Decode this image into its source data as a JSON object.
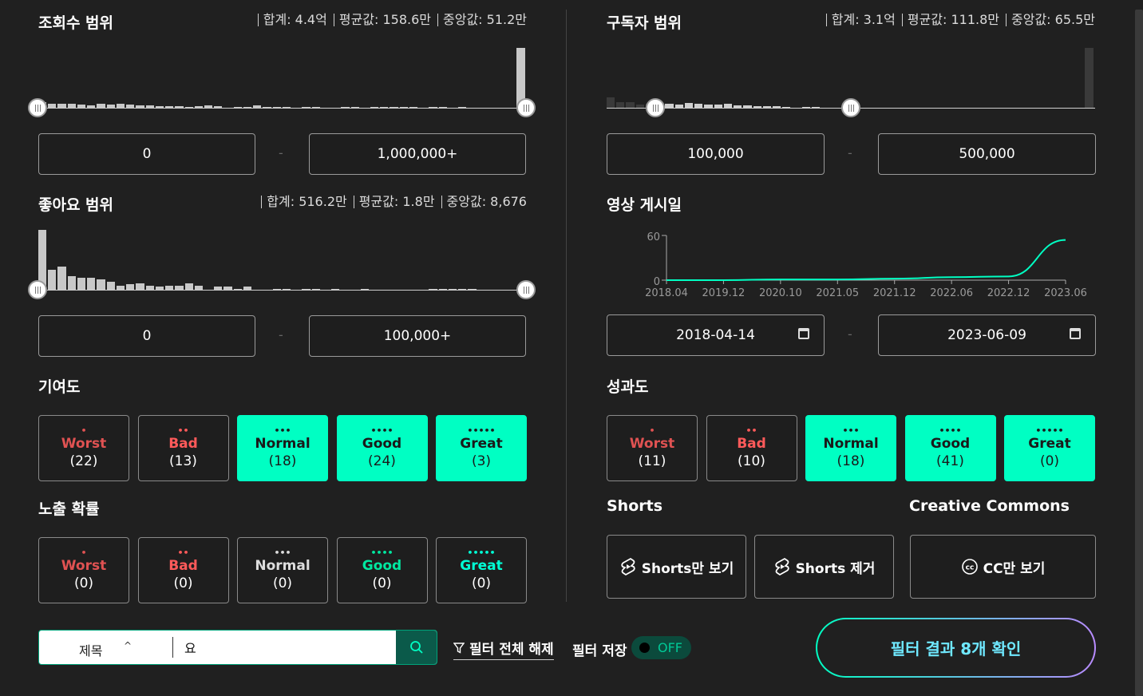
{
  "views": {
    "title": "조회수 범위",
    "stats": [
      "합계: 4.4억",
      "평균값: 158.6만",
      "중앙값: 51.2만"
    ],
    "min": "0",
    "max": "1,000,000+",
    "histogram": [
      0.1,
      0.08,
      0.07,
      0.07,
      0.06,
      0.05,
      0.07,
      0.06,
      0.08,
      0.06,
      0.05,
      0.05,
      0.04,
      0.04,
      0.04,
      0.03,
      0.04,
      0.05,
      0.04,
      0.0,
      0.03,
      0.03,
      0.05,
      0.03,
      0.03,
      0.03,
      0.0,
      0.02,
      0.02,
      0.0,
      0.0,
      0.02,
      0.02,
      0.0,
      0.02,
      0.02,
      0.02,
      0.02,
      0.02,
      0.0,
      0.02,
      0.02,
      0.0,
      0.02,
      0.0,
      0.0,
      0.0,
      0.0,
      0.0,
      0.95
    ]
  },
  "likes": {
    "title": "좋아요 범위",
    "stats": [
      "합계: 516.2만",
      "평균값: 1.8만",
      "중앙값: 8,676"
    ],
    "min": "0",
    "max": "100,000+",
    "histogram": [
      0.95,
      0.32,
      0.38,
      0.22,
      0.2,
      0.2,
      0.18,
      0.14,
      0.08,
      0.1,
      0.11,
      0.08,
      0.06,
      0.08,
      0.07,
      0.11,
      0.07,
      0.0,
      0.06,
      0.06,
      0.03,
      0.06,
      0.0,
      0.0,
      0.02,
      0.02,
      0.0,
      0.02,
      0.02,
      0.0,
      0.02,
      0.0,
      0.0,
      0.02,
      0.0,
      0.0,
      0.0,
      0.0,
      0.0,
      0.0,
      0.02,
      0.02,
      0.02,
      0.02,
      0.02,
      0.0,
      0.0,
      0.0,
      0.0,
      0.02
    ]
  },
  "subscribers": {
    "title": "구독자 범위",
    "stats": [
      "합계: 3.1억",
      "평균값: 111.8만",
      "중앙값: 65.5만"
    ],
    "min": "100,000",
    "max": "500,000",
    "sel_range": [
      0.1,
      0.5
    ],
    "histogram": [
      0.18,
      0.1,
      0.1,
      0.06,
      0.07,
      0.08,
      0.07,
      0.06,
      0.09,
      0.07,
      0.06,
      0.06,
      0.07,
      0.05,
      0.05,
      0.04,
      0.04,
      0.04,
      0.03,
      0.0,
      0.02,
      0.02,
      0.0,
      0.0,
      0.02,
      0.0,
      0.0,
      0.0,
      0.0,
      0.0,
      0.0,
      0.0,
      0.0,
      0.0,
      0.0,
      0.0,
      0.0,
      0.0,
      0.0,
      0.0,
      0.0,
      0.0,
      0.0,
      0.0,
      0.0,
      0.0,
      0.0,
      0.0,
      0.0,
      0.95
    ]
  },
  "upload_date": {
    "title": "영상 게시일",
    "start": "2018-04-14",
    "end": "2023-06-09"
  },
  "chart_data": {
    "type": "line",
    "x": [
      "2018.04",
      "2019.12",
      "2020.10",
      "2021.05",
      "2021.12",
      "2022.06",
      "2022.12",
      "2023.06"
    ],
    "ylim": [
      0,
      60
    ],
    "y_ticks": [
      "60",
      "0"
    ],
    "series": [
      {
        "values": [
          0,
          0,
          1,
          1,
          2,
          4,
          5,
          54
        ]
      }
    ]
  },
  "contribution": {
    "title": "기여도",
    "items": [
      {
        "dots": "•",
        "name": "Worst",
        "count": "(22)",
        "on": false,
        "cls": "c-worst"
      },
      {
        "dots": "••",
        "name": "Bad",
        "count": "(13)",
        "on": false,
        "cls": "c-bad"
      },
      {
        "dots": "•••",
        "name": "Normal",
        "count": "(18)",
        "on": true,
        "cls": "c-normal"
      },
      {
        "dots": "••••",
        "name": "Good",
        "count": "(24)",
        "on": true,
        "cls": "c-good"
      },
      {
        "dots": "•••••",
        "name": "Great",
        "count": "(3)",
        "on": true,
        "cls": "c-great"
      }
    ]
  },
  "exposure": {
    "title": "노출 확률",
    "items": [
      {
        "dots": "•",
        "name": "Worst",
        "count": "(0)",
        "on": false,
        "cls": "c-worst"
      },
      {
        "dots": "••",
        "name": "Bad",
        "count": "(0)",
        "on": false,
        "cls": "c-bad"
      },
      {
        "dots": "•••",
        "name": "Normal",
        "count": "(0)",
        "on": false,
        "cls": "c-normal"
      },
      {
        "dots": "••••",
        "name": "Good",
        "count": "(0)",
        "on": false,
        "cls": "c-good"
      },
      {
        "dots": "•••••",
        "name": "Great",
        "count": "(0)",
        "on": false,
        "cls": "c-great"
      }
    ]
  },
  "performance": {
    "title": "성과도",
    "items": [
      {
        "dots": "•",
        "name": "Worst",
        "count": "(11)",
        "on": false,
        "cls": "c-worst"
      },
      {
        "dots": "••",
        "name": "Bad",
        "count": "(10)",
        "on": false,
        "cls": "c-bad"
      },
      {
        "dots": "•••",
        "name": "Normal",
        "count": "(18)",
        "on": true,
        "cls": "c-normal"
      },
      {
        "dots": "••••",
        "name": "Good",
        "count": "(41)",
        "on": true,
        "cls": "c-good"
      },
      {
        "dots": "•••••",
        "name": "Great",
        "count": "(0)",
        "on": true,
        "cls": "c-great"
      }
    ]
  },
  "shorts": {
    "title": "Shorts",
    "only_label": "Shorts만 보기",
    "remove_label": "Shorts 제거"
  },
  "cc": {
    "title": "Creative Commons",
    "only_label": "CC만 보기"
  },
  "search": {
    "field": "제목",
    "value": "요"
  },
  "reset_label": "필터 전체 해제",
  "save_label": "필터 저장",
  "toggle_label": "OFF",
  "confirm_label": "필터 결과 8개 확인",
  "colors": {
    "accent": "#00ffc3",
    "background": "#202020"
  }
}
